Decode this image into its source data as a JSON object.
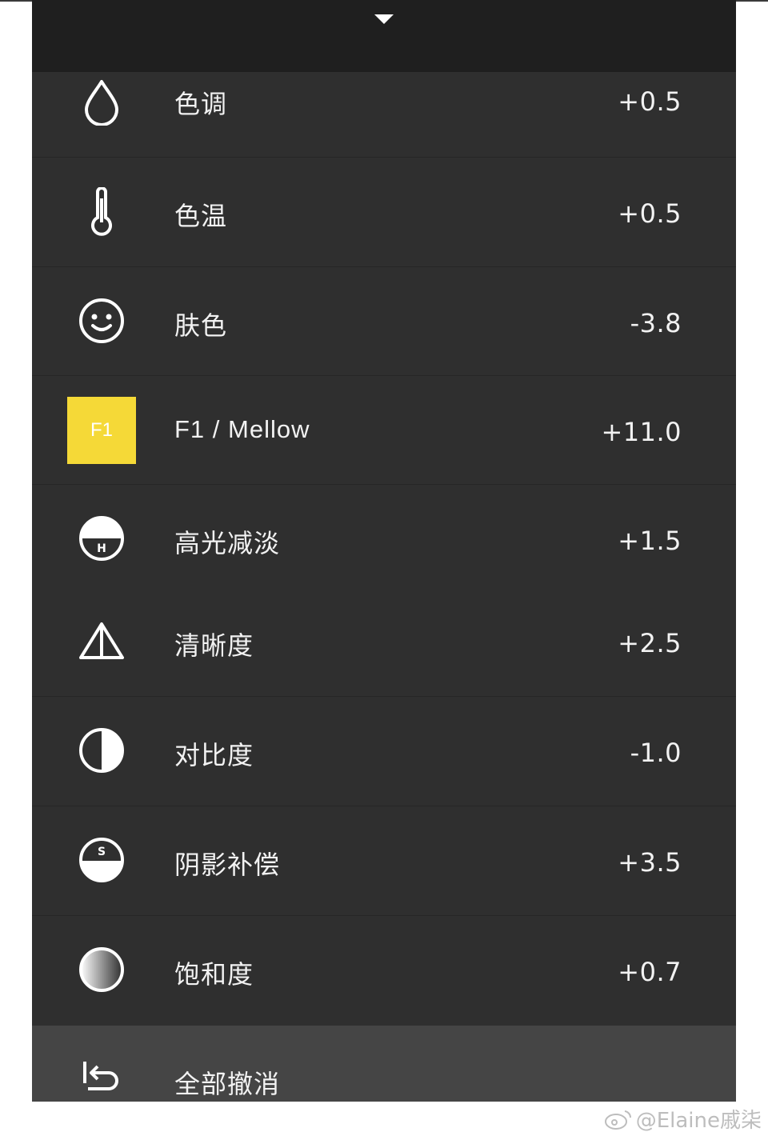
{
  "rows": [
    {
      "id": "tone",
      "label": "色调",
      "value": "+0.5",
      "icon": "droplet-icon"
    },
    {
      "id": "temperature",
      "label": "色温",
      "value": "+0.5",
      "icon": "thermometer-icon"
    },
    {
      "id": "skin",
      "label": "肤色",
      "value": "-3.8",
      "icon": "smiley-face-icon"
    },
    {
      "id": "filter",
      "label": "F1 / Mellow",
      "value": "+11.0",
      "icon": "filter-badge",
      "badge": "F1",
      "badge_color": "#F5D937"
    },
    {
      "id": "highlights",
      "label": "高光减淡",
      "value": "+1.5",
      "icon": "highlight-icon",
      "icon_letter": "H"
    },
    {
      "id": "sharpness",
      "label": "清晰度",
      "value": "+2.5",
      "icon": "triangle-icon"
    },
    {
      "id": "contrast",
      "label": "对比度",
      "value": "-1.0",
      "icon": "half-circle-icon"
    },
    {
      "id": "shadows",
      "label": "阴影补偿",
      "value": "+3.5",
      "icon": "shadow-icon",
      "icon_letter": "S"
    },
    {
      "id": "saturation",
      "label": "饱和度",
      "value": "+0.7",
      "icon": "gradient-circle-icon"
    }
  ],
  "reset": {
    "label": "全部撤消",
    "icon": "undo-icon"
  },
  "watermark": {
    "text": "@Elaine戚柒",
    "icon": "weibo-icon"
  },
  "colors": {
    "panel": "#2F2F2F",
    "top_bar": "#1F1F1F",
    "reset_bar": "#454545",
    "text": "#F2F2F2",
    "accent": "#F5D937"
  }
}
